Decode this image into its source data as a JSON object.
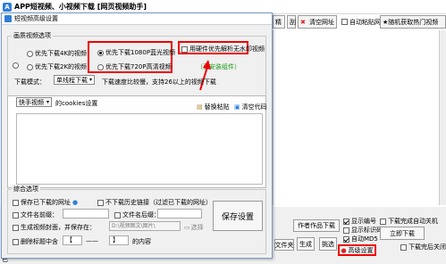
{
  "main": {
    "title": "APP短视频、小视频下载 [网页视频助手]",
    "toolbar": {
      "batch_partial": "精",
      "flip_partial": "刮",
      "clear_url": "清空网址",
      "auto_paste": "自动粘贴网址",
      "random_hot": "★随机获取热门视频"
    },
    "bottom": {
      "row1_left": "站",
      "row2_left": "单",
      "works_download": "作者作品下载",
      "file_dir": "文件夹",
      "generate": "生成",
      "select": "挑选",
      "advanced_settings": "高级设置",
      "download_now": "立即下载",
      "show_number": "显示编号",
      "show_tag": "显示标识码",
      "auto_md5": "自动MD5",
      "auto_close": "下载完成自动关机",
      "close_after": "下载完后关闭",
      "bottom_partial": "已"
    }
  },
  "dialog": {
    "title": "短视频高级设置",
    "video_options": {
      "label": "画质视频选项",
      "opt_4k": "优先下载4K的视频",
      "opt_1080p": "优先下载1080P蓝光视频",
      "opt_2k": "优先下载2K的视频",
      "opt_720p": "优先下载720P高清视频",
      "opt_other": "",
      "no_watermark": "用硬件优先解析无水印视频",
      "installed_note": "（已安装组件）",
      "mode_label": "下载模式：",
      "mode_value": "单线程下载",
      "mode_desc": "下载速度比较慢，支持26以上的视频下载"
    },
    "cookies": {
      "platform": "快手视频",
      "suffix": "的cookies设置",
      "paste": "替换粘贴",
      "clear": "清空代码"
    },
    "general": {
      "label": "综合选项",
      "save_url": "保存已下载的网址",
      "skip_history": "不下载历史链接（过滤已下载的网址）",
      "file_prefix": "文件名前缀：",
      "file_suffix": "文件名后缀：",
      "gen_thumb": "生成视频封面，并保存在：",
      "thumb_path": "D:\\视频图文\\图片\\",
      "choose": "选择",
      "delete_feature": "删除标题中含",
      "range_sep": "——",
      "range_tail": "的内容",
      "range_open": "【",
      "range_close": "】",
      "save_settings": "保存设置"
    }
  }
}
